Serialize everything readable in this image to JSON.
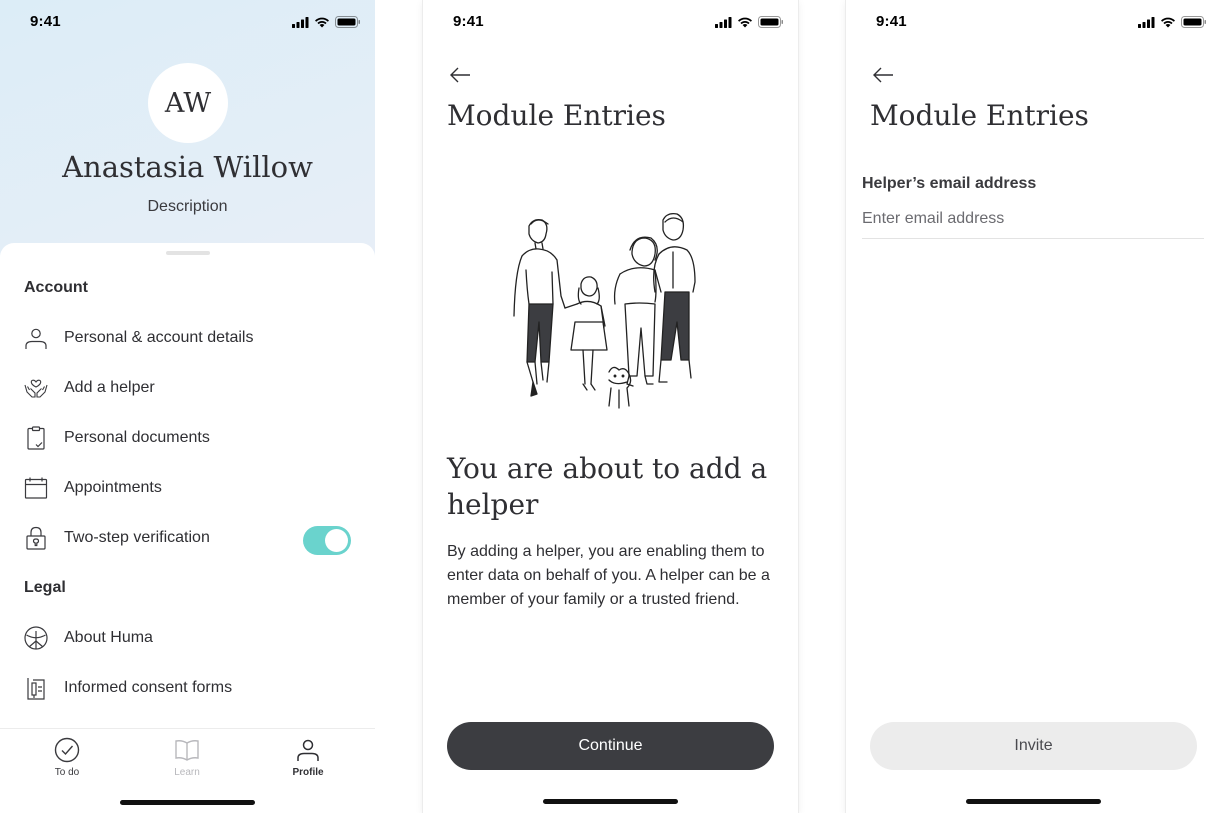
{
  "status": {
    "time": "9:41"
  },
  "profile": {
    "initials": "AW",
    "name": "Anastasia Willow",
    "description": "Description",
    "account_heading": "Account",
    "account_items": [
      {
        "label": "Personal & account details",
        "icon": "person-icon"
      },
      {
        "label": "Add a helper",
        "icon": "hands-heart-icon"
      },
      {
        "label": "Personal documents",
        "icon": "clipboard-icon"
      },
      {
        "label": "Appointments",
        "icon": "calendar-icon"
      },
      {
        "label": "Two-step verification",
        "icon": "lock-icon",
        "toggle_on": true
      }
    ],
    "legal_heading": "Legal",
    "legal_items": [
      {
        "label": "About Huma",
        "icon": "huma-logo-icon"
      },
      {
        "label": "Informed consent forms",
        "icon": "consent-form-icon"
      }
    ],
    "tabs": [
      {
        "label": "To do",
        "icon": "check-circle-icon",
        "state": "default"
      },
      {
        "label": "Learn",
        "icon": "book-icon",
        "state": "disabled"
      },
      {
        "label": "Profile",
        "icon": "person-icon",
        "state": "active"
      }
    ]
  },
  "helper_intro": {
    "title": "Module Entries",
    "heading": "You are about to add a helper",
    "body": "By adding a helper, you are enabling them to enter data on behalf of you. A helper can be a member of your family or a trusted friend.",
    "button": "Continue"
  },
  "helper_email": {
    "title": "Module Entries",
    "field_label": "Helper’s email address",
    "field_placeholder": "Enter email address",
    "field_value": "",
    "button": "Invite"
  },
  "colors": {
    "toggle": "#6ad3cd",
    "primary_button": "#3c3d41",
    "disabled_button": "#ececec",
    "text": "#2f2f33"
  }
}
